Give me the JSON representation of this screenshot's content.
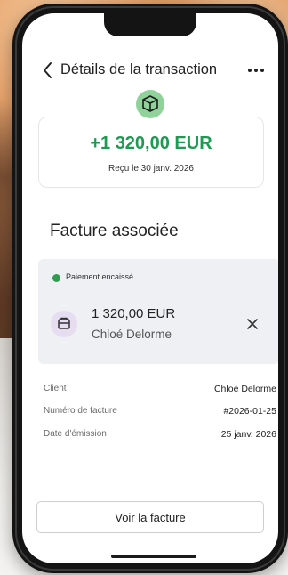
{
  "header": {
    "title": "Détails de la transaction"
  },
  "transaction": {
    "amount": "+1 320,00 EUR",
    "received_date": "Reçu le 30 janv. 2026"
  },
  "section": {
    "title": "Facture associée"
  },
  "invoice": {
    "status": "Paiement encaissé",
    "amount": "1 320,00 EUR",
    "client": "Chloé Delorme"
  },
  "details": [
    {
      "label": "Client",
      "value": "Chloé Delorme"
    },
    {
      "label": "Numéro de facture",
      "value": "#2026-01-25"
    },
    {
      "label": "Date d'émission",
      "value": "25 janv. 2026"
    }
  ],
  "actions": {
    "view_invoice": "Voir la facture"
  },
  "colors": {
    "amount_green": "#1f9a52",
    "status_green": "#2f9c4f",
    "avatar_green": "#8fd39a",
    "invoice_icon_bg": "#e7ddf1",
    "panel_bg": "#eef0f4"
  },
  "icons": {
    "back": "chevron-left-icon",
    "more": "more-horizontal-icon",
    "transaction": "package-icon",
    "invoice": "document-icon",
    "remove": "close-icon"
  }
}
